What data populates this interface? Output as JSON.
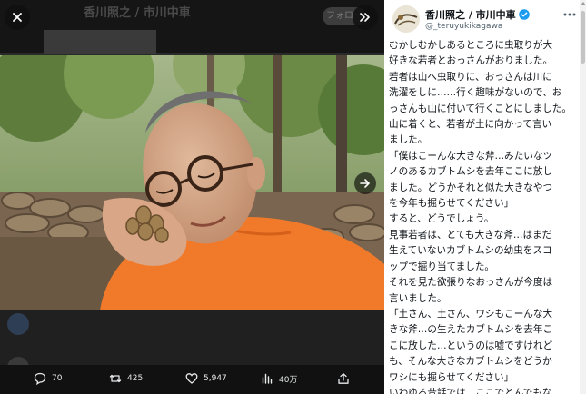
{
  "background": {
    "header_title": "香川照之 / 市川中車",
    "follow_label": "フォロー"
  },
  "overlay": {
    "close_icon": "close-icon",
    "collapse_icon": "double-chevron-right-icon",
    "next_icon": "arrow-right-icon"
  },
  "actions": {
    "replies": "70",
    "reposts": "425",
    "likes": "5,947",
    "views": "40万"
  },
  "author": {
    "name": "香川照之 / 市川中車",
    "handle": "@_teruyukikagawa",
    "verified_color": "#1d9bf0"
  },
  "post": {
    "lines": [
      "むかしむかしあるところに虫取りが大",
      "好きな若者とおっさんがおりました。",
      "若者は山へ虫取りに、おっさんは川に",
      "洗濯をしに……行く趣味がないので、お",
      "っさんも山に付いて行くことにしました。",
      "山に着くと、若者が土に向かって言い",
      "ました。",
      "「僕はこーんな大きな斧…みたいなツ",
      "ノのあるカブトムシを去年ここに放し",
      "ました。どうかそれと似た大きなやつ",
      "を今年も掘らせてください」",
      "すると、どうでしょう。",
      "見事若者は、とても大きな斧…はまだ",
      "生えていないカブトムシの幼虫をスコ",
      "ップで掘り当てました。",
      "それを見た欲張りなおっさんが今度は",
      "言いました。",
      "「土さん、土さん、ワシもこーんな大",
      "きな斧…の生えたカブトムシを去年こ",
      "こに放した…というのは嘘ですけれど",
      "も、そんな大きなカブトムシをどうか",
      "ワシにも掘らせてください」",
      "いわゆる昔話では、ここでとんでもな"
    ]
  }
}
